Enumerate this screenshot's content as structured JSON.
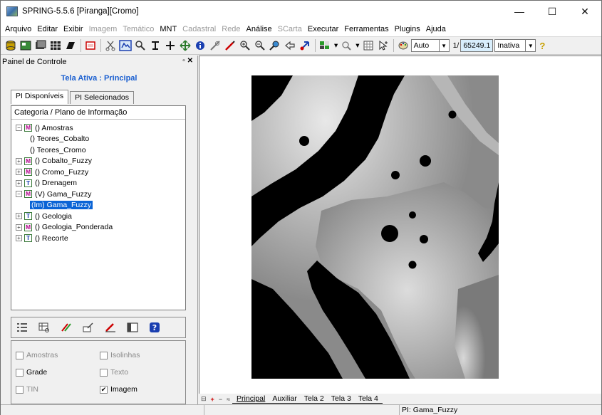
{
  "window": {
    "title": "SPRING-5.5.6 [Piranga][Cromo]",
    "minimize": "—",
    "maximize": "☐",
    "close": "✕"
  },
  "menu": [
    {
      "label": "Arquivo",
      "enabled": true
    },
    {
      "label": "Editar",
      "enabled": true
    },
    {
      "label": "Exibir",
      "enabled": true
    },
    {
      "label": "Imagem",
      "enabled": false
    },
    {
      "label": "Temático",
      "enabled": false
    },
    {
      "label": "MNT",
      "enabled": true
    },
    {
      "label": "Cadastral",
      "enabled": false
    },
    {
      "label": "Rede",
      "enabled": false
    },
    {
      "label": "Análise",
      "enabled": true
    },
    {
      "label": "SCarta",
      "enabled": false
    },
    {
      "label": "Executar",
      "enabled": true
    },
    {
      "label": "Ferramentas",
      "enabled": true
    },
    {
      "label": "Plugins",
      "enabled": true
    },
    {
      "label": "Ajuda",
      "enabled": true
    }
  ],
  "toolbar": {
    "scale_mode": "Auto",
    "scale_prefix": "1/",
    "scale_value": "65249.1",
    "state": "Inativa",
    "help": "?"
  },
  "panel": {
    "title": "Painel de Controle",
    "controls": "▫ ✕",
    "active_screen": "Tela Ativa : Principal",
    "tab_available": "PI Disponíveis",
    "tab_selected": "PI Selecionados",
    "tree_header": "Categoria / Plano de Informação",
    "tree": [
      {
        "label": "() Amostras",
        "level": 0,
        "badge": "M",
        "expander": "−"
      },
      {
        "label": "() Teores_Cobalto",
        "level": 1
      },
      {
        "label": "() Teores_Cromo",
        "level": 1
      },
      {
        "label": "() Cobalto_Fuzzy",
        "level": 0,
        "badge": "M",
        "expander": "+"
      },
      {
        "label": "() Cromo_Fuzzy",
        "level": 0,
        "badge": "M",
        "expander": "+"
      },
      {
        "label": "() Drenagem",
        "level": 0,
        "badge": "T",
        "expander": "+"
      },
      {
        "label": "(V) Gama_Fuzzy",
        "level": 0,
        "badge": "M",
        "expander": "−"
      },
      {
        "label": "(Im) Gama_Fuzzy",
        "level": 1,
        "selected": true
      },
      {
        "label": "() Geologia",
        "level": 0,
        "badge": "T",
        "expander": "+"
      },
      {
        "label": "() Geologia_Ponderada",
        "level": 0,
        "badge": "M",
        "expander": "+"
      },
      {
        "label": "() Recorte",
        "level": 0,
        "badge": "T",
        "expander": "+"
      }
    ],
    "checks": {
      "amostras": "Amostras",
      "isolinhas": "Isolinhas",
      "grade": "Grade",
      "texto": "Texto",
      "tin": "TIN",
      "imagem": "Imagem"
    }
  },
  "screen_tabs": {
    "nav": [
      "⊟",
      "+",
      "−",
      "≈"
    ],
    "tabs": [
      "Principal",
      "Auxiliar",
      "Tela 2",
      "Tela 3",
      "Tela 4"
    ]
  },
  "status": {
    "pi": "PI: Gama_Fuzzy"
  }
}
